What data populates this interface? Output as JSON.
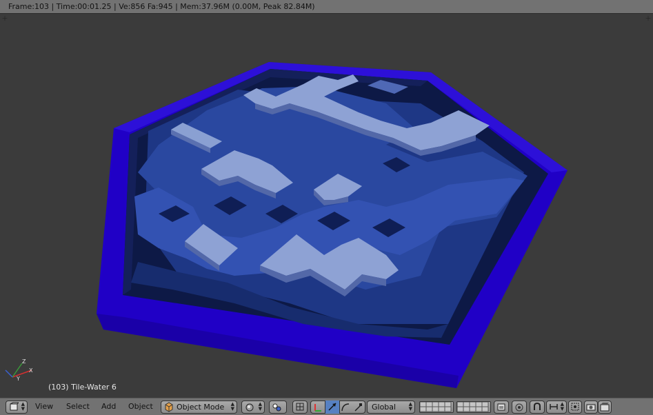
{
  "info_bar": {
    "text": "Frame:103 | Time:00:01.25 | Ve:856 Fa:945 | Mem:37.96M (0.00M, Peak 82.84M)"
  },
  "viewport": {
    "object_label": "(103) Tile-Water 6",
    "axis_labels": {
      "x": "X",
      "y": "Y",
      "z": "Z"
    }
  },
  "header": {
    "menus": [
      "View",
      "Select",
      "Add",
      "Object"
    ],
    "mode": "Object Mode",
    "transform_orientation": "Global"
  },
  "icons": [
    "editor-type-icon",
    "viewport-shading-icon",
    "pivot-point-icon",
    "manipulator-icon",
    "translate-icon",
    "rotate-icon",
    "scale-icon",
    "layers-icon",
    "lock-layers-icon",
    "proportional-edit-icon",
    "snap-icon",
    "snap-element-icon",
    "render-icon",
    "anim-icon"
  ],
  "colors": {
    "rim": "#2200c8",
    "water_dark": "#0d1a4a",
    "water_mid": "#233f8c",
    "foam": "#8b9fd0",
    "background": "#3b3b3b",
    "header": "#727272"
  }
}
